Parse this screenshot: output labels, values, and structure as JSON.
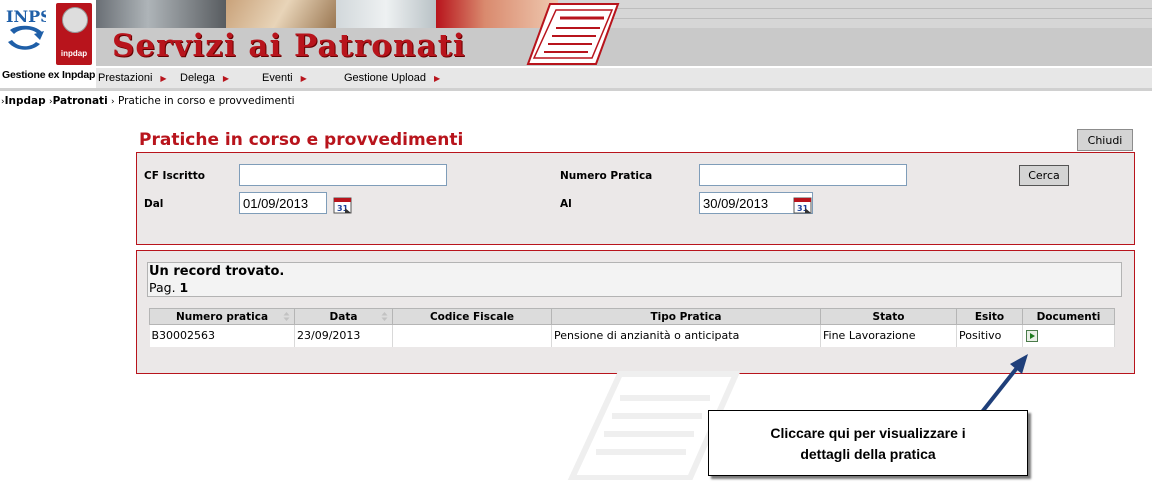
{
  "header": {
    "inps_logo_text": "INPS",
    "inpdap_logo_text": "inpdap",
    "gestione_label": "Gestione ex Inpdap",
    "banner_title": "Servizi ai Patronati"
  },
  "menu": {
    "items": [
      {
        "label": "Prestazioni"
      },
      {
        "label": "Delega"
      },
      {
        "label": "Eventi"
      },
      {
        "label": "Gestione Upload"
      }
    ]
  },
  "breadcrumb": {
    "item1": "Inpdap",
    "item2": "Patronati",
    "item3": "Pratiche in corso e provvedimenti"
  },
  "page": {
    "title": "Pratiche in corso e provvedimenti",
    "close_label": "Chiudi"
  },
  "search": {
    "cf_label": "CF Iscritto",
    "cf_value": "",
    "numero_label": "Numero Pratica",
    "numero_value": "",
    "dal_label": "Dal",
    "dal_value": "01/09/2013",
    "al_label": "Al",
    "al_value": "30/09/2013",
    "search_label": "Cerca",
    "calendar_icon_text": "31"
  },
  "results": {
    "count_text": "Un record trovato.",
    "page_label": "Pag.",
    "page_number": "1",
    "columns": [
      "Numero pratica",
      "Data",
      "Codice Fiscale",
      "Tipo Pratica",
      "Stato",
      "Esito",
      "Documenti"
    ],
    "rows": [
      {
        "numero": "B30002563",
        "data": "23/09/2013",
        "codice_fiscale": "",
        "tipo": "Pensione di anzianità o anticipata",
        "stato": "Fine Lavorazione",
        "esito": "Positivo"
      }
    ]
  },
  "callout": {
    "line1": "Cliccare qui per visualizzare i",
    "line2": "dettagli della pratica"
  },
  "colors": {
    "brand_red": "#b8141c",
    "panel_bg": "#ebe8e8",
    "header_gray": "#c9c9c9"
  }
}
